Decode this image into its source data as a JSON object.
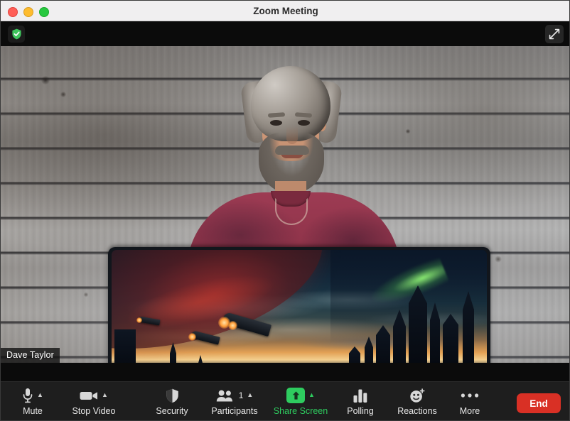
{
  "window": {
    "title": "Zoom Meeting",
    "traffic_lights": [
      "close",
      "minimize",
      "maximize"
    ]
  },
  "video_overlay": {
    "encryption_icon": "green-shield-check-icon",
    "fullscreen_icon": "expand-diagonal-arrows-icon",
    "participant_name": "Dave Taylor"
  },
  "video_scene": {
    "background": "weathered grey wooden plank wall",
    "person": "man with grey curly hair and beard wearing a maroon t-shirt",
    "foreground": "open laptop showing a sci-fi spaceship and futuristic city wallpaper"
  },
  "toolbar": {
    "items": [
      {
        "label": "Mute",
        "icon": "microphone-icon",
        "chevron": true,
        "badge": ""
      },
      {
        "label": "Stop Video",
        "icon": "video-camera-icon",
        "chevron": true,
        "badge": ""
      },
      {
        "label": "Security",
        "icon": "shield-icon",
        "chevron": false,
        "badge": ""
      },
      {
        "label": "Participants",
        "icon": "people-icon",
        "chevron": true,
        "badge": "1"
      },
      {
        "label": "Share Screen",
        "icon": "share-up-arrow-icon",
        "chevron": true,
        "badge": ""
      },
      {
        "label": "Polling",
        "icon": "bar-chart-icon",
        "chevron": false,
        "badge": ""
      },
      {
        "label": "Reactions",
        "icon": "smiley-plus-icon",
        "chevron": false,
        "badge": ""
      },
      {
        "label": "More",
        "icon": "ellipsis-icon",
        "chevron": false,
        "badge": ""
      }
    ],
    "end_label": "End"
  },
  "colors": {
    "accent_green": "#2ecc5f",
    "end_red": "#d93025",
    "toolbar_bg": "#1e1e1e",
    "titlebar_bg": "#f0eff0",
    "traffic_red": "#ff5f57",
    "traffic_yellow": "#febc2e",
    "traffic_green": "#28c840"
  }
}
